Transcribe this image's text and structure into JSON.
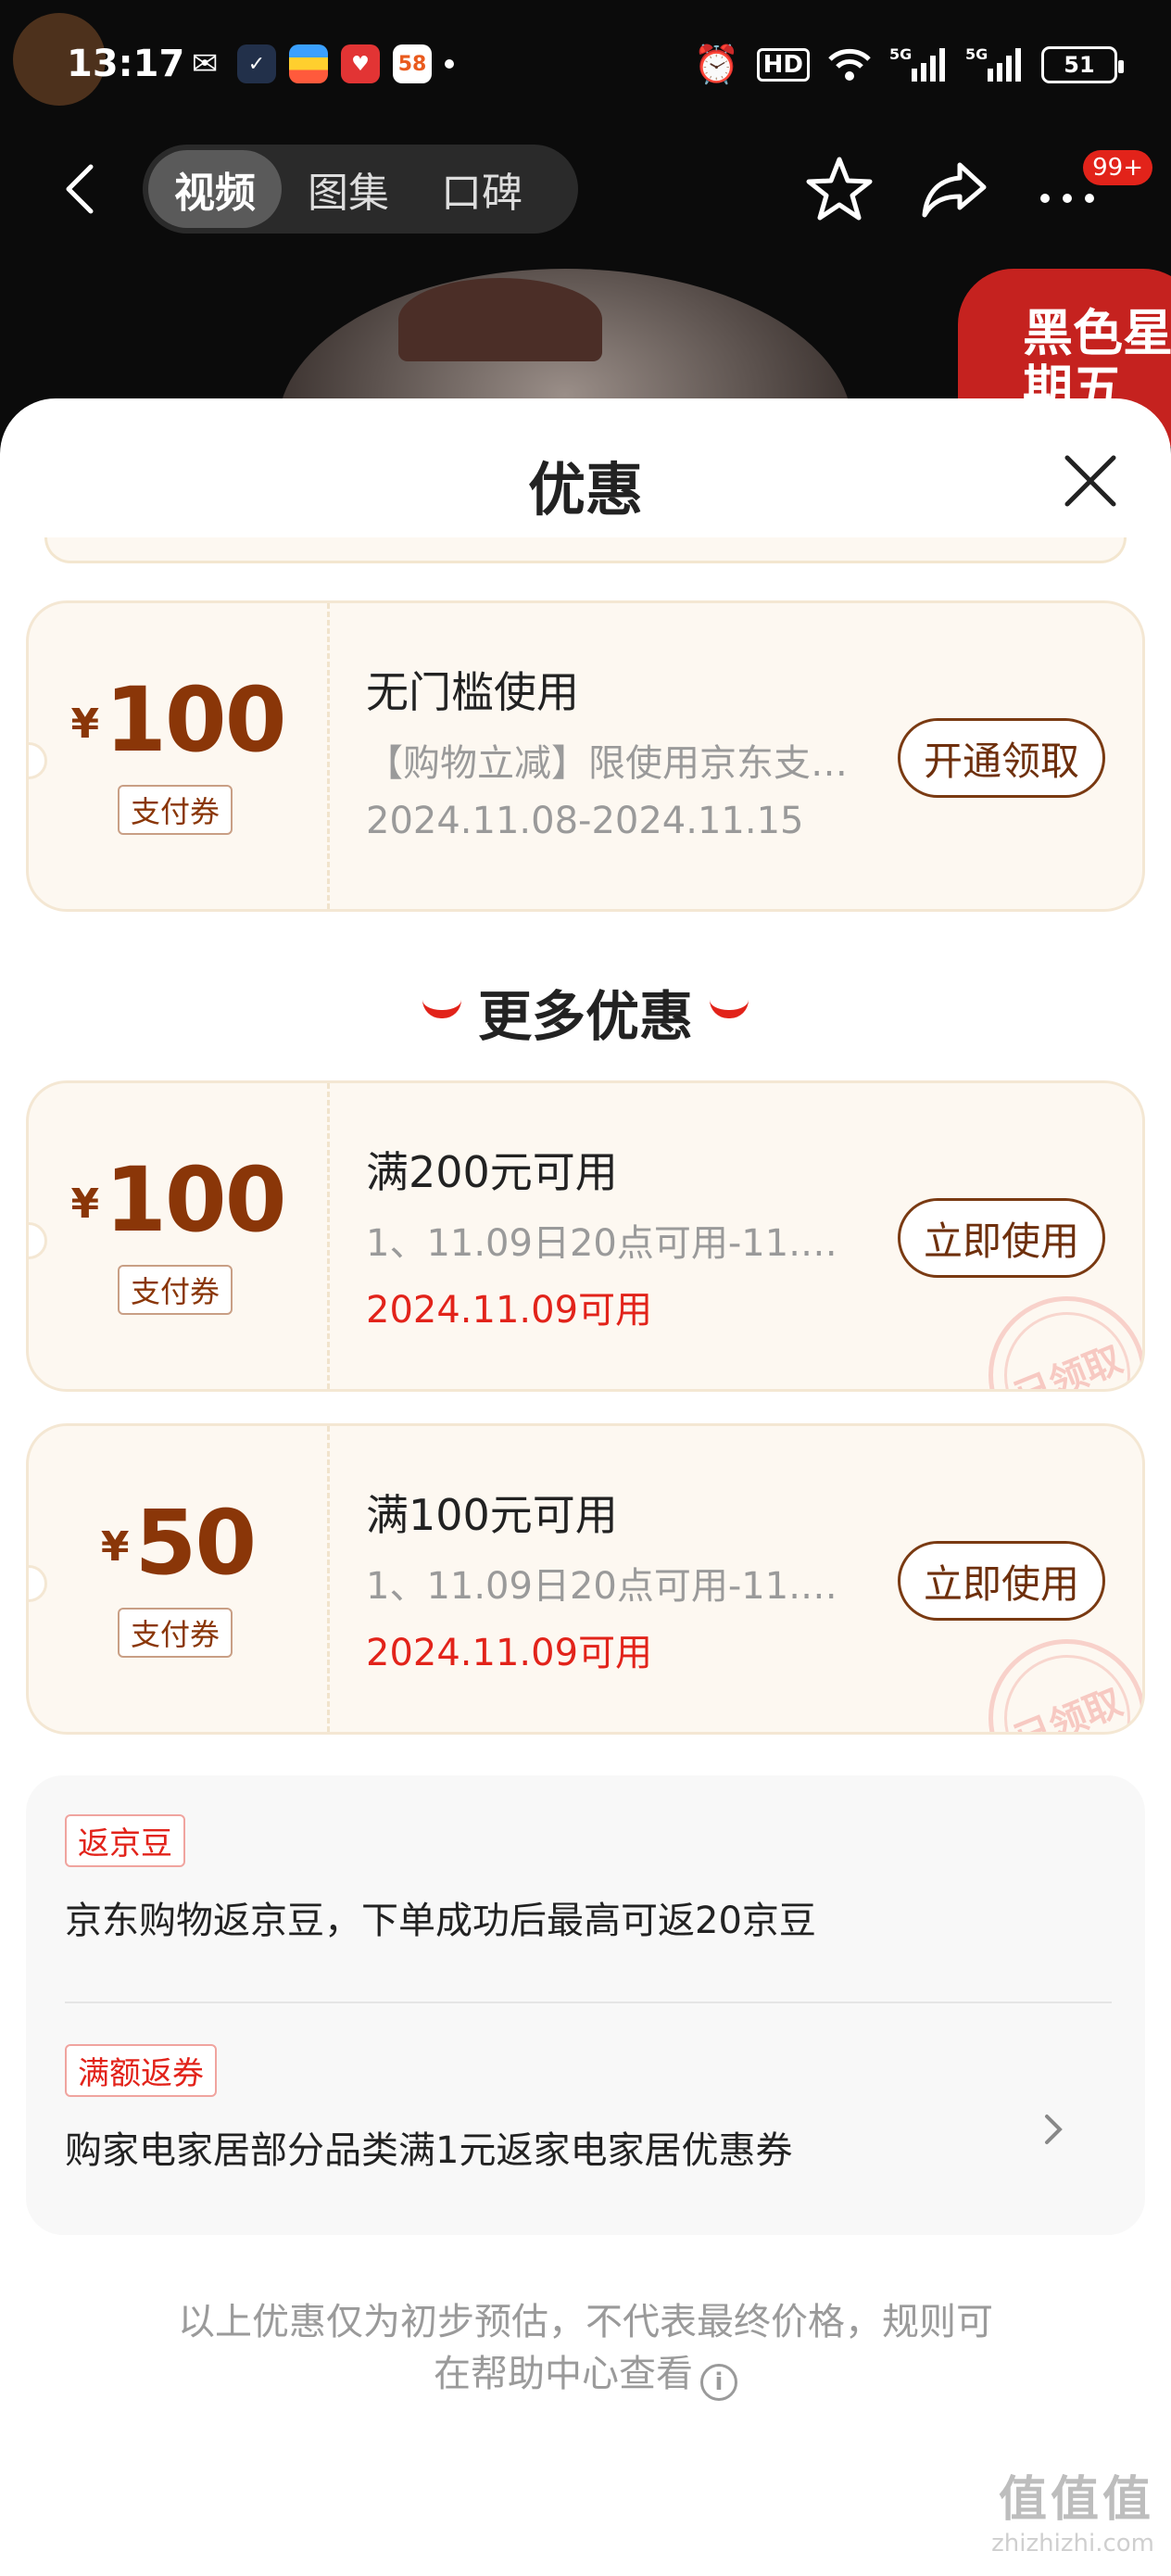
{
  "status_bar": {
    "time": "13:17",
    "battery": "51",
    "hd": "HD"
  },
  "nav": {
    "tabs": [
      "视频",
      "图集",
      "口碑"
    ],
    "active_tab": 0,
    "badge": "99+"
  },
  "background": {
    "sticker_text": "黑色星期五"
  },
  "sheet": {
    "title": "优惠",
    "coupons_top": [
      {
        "currency": "¥",
        "amount": "100",
        "tag": "支付券",
        "title": "无门槛使用",
        "desc": "【购物立减】限使用京东支…",
        "date": "2024.11.08-2024.11.15",
        "button": "开通领取",
        "claimed": false
      }
    ],
    "more_title": "更多优惠",
    "coupons_more": [
      {
        "currency": "¥",
        "amount": "100",
        "tag": "支付券",
        "title": "满200元可用",
        "desc": "1、11.09日20点可用-11.1…",
        "date": "2024.11.09可用",
        "button": "立即使用",
        "stamp": "已领取"
      },
      {
        "currency": "¥",
        "amount": "50",
        "tag": "支付券",
        "title": "满100元可用",
        "desc": "1、11.09日20点可用-11.1…",
        "date": "2024.11.09可用",
        "button": "立即使用",
        "stamp": "已领取"
      }
    ],
    "benefits": [
      {
        "tag": "返京豆",
        "text": "京东购物返京豆，下单成功后最高可返20京豆"
      },
      {
        "tag": "满额返券",
        "text": "购家电家居部分品类满1元返家电家居优惠券"
      }
    ],
    "footer_line1": "以上优惠仅为初步预估，不代表最终价格，规则可",
    "footer_line2": "在帮助中心查看",
    "watermark_main": "值值值",
    "watermark_sub": "zhizhizhi.com"
  },
  "colors": {
    "accent_red": "#e2231a",
    "coupon_brown": "#8a3608",
    "coupon_bg": "#fdf8f1"
  }
}
